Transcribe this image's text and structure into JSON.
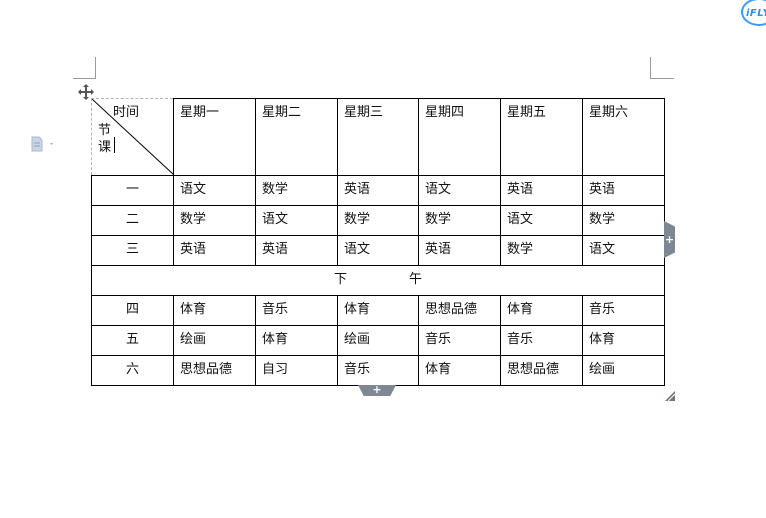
{
  "logo": {
    "text": "iFLY"
  },
  "table": {
    "header": {
      "corner_top": "时间",
      "corner_left_1": "节",
      "corner_left_2": "课",
      "days": [
        "星期一",
        "星期二",
        "星期三",
        "星期四",
        "星期五",
        "星期六"
      ]
    },
    "morning": [
      {
        "period": "一",
        "classes": [
          "语文",
          "数学",
          "英语",
          "语文",
          "英语",
          "英语"
        ]
      },
      {
        "period": "二",
        "classes": [
          "数学",
          "语文",
          "数学",
          "数学",
          "语文",
          "数学"
        ]
      },
      {
        "period": "三",
        "classes": [
          "英语",
          "英语",
          "语文",
          "英语",
          "数学",
          "语文"
        ]
      }
    ],
    "afternoon_label_1": "下",
    "afternoon_label_2": "午",
    "afternoon": [
      {
        "period": "四",
        "classes": [
          "体育",
          "音乐",
          "体育",
          "思想品德",
          "体育",
          "音乐"
        ]
      },
      {
        "period": "五",
        "classes": [
          "绘画",
          "体育",
          "绘画",
          "音乐",
          "音乐",
          "体育"
        ]
      },
      {
        "period": "六",
        "classes": [
          "思想品德",
          "自习",
          "音乐",
          "体育",
          "思想品德",
          "绘画"
        ]
      }
    ]
  },
  "controls": {
    "add_column_symbol": "+",
    "add_row_symbol": "+"
  },
  "icons": [
    "move-handle-icon",
    "document-icon",
    "resize-handle-icon"
  ],
  "colors": {
    "logo": "#3b9bf0",
    "tab": "#7d8893"
  }
}
